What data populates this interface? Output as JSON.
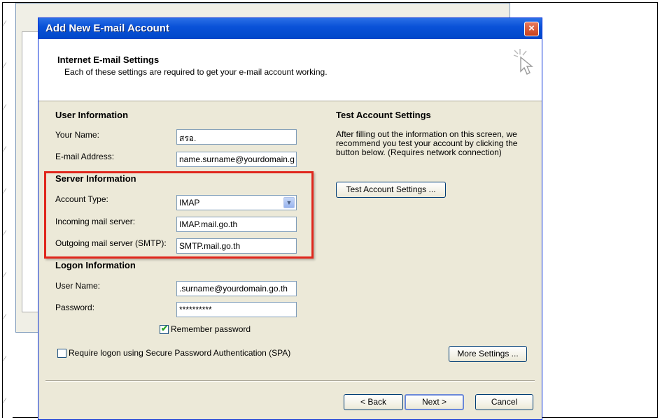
{
  "dialog": {
    "title": "Add New E-mail Account",
    "close_label": "×"
  },
  "header": {
    "title": "Internet E-mail Settings",
    "subtitle": "Each of these settings are required to get your e-mail account working."
  },
  "user_info": {
    "section_title": "User Information",
    "name_label": "Your Name:",
    "name_value": "สรอ.",
    "email_label": "E-mail Address:",
    "email_value": "name.surname@yourdomain.g"
  },
  "server_info": {
    "section_title": "Server Information",
    "account_type_label": "Account Type:",
    "account_type_value": "IMAP",
    "incoming_label": "Incoming mail server:",
    "incoming_value": "IMAP.mail.go.th",
    "outgoing_label": "Outgoing mail server (SMTP):",
    "outgoing_value": "SMTP.mail.go.th"
  },
  "logon_info": {
    "section_title": "Logon Information",
    "username_label": "User Name:",
    "username_value": ".surname@yourdomain.go.th",
    "password_label": "Password:",
    "password_value": "**********",
    "remember_label": "Remember password",
    "remember_checked": true,
    "spa_label": "Require logon using Secure Password Authentication (SPA)",
    "spa_checked": false
  },
  "test_settings": {
    "section_title": "Test Account Settings",
    "description": "After filling out the information on this screen, we recommend you test your account by clicking the button below. (Requires network connection)",
    "button_label": "Test Account Settings ..."
  },
  "buttons": {
    "more_settings": "More Settings ...",
    "back": "< Back",
    "next": "Next >",
    "cancel": "Cancel"
  },
  "colors": {
    "highlight_box": "#e0261c",
    "titlebar": "#0a52d8",
    "dialog_bg": "#ece9d8"
  }
}
